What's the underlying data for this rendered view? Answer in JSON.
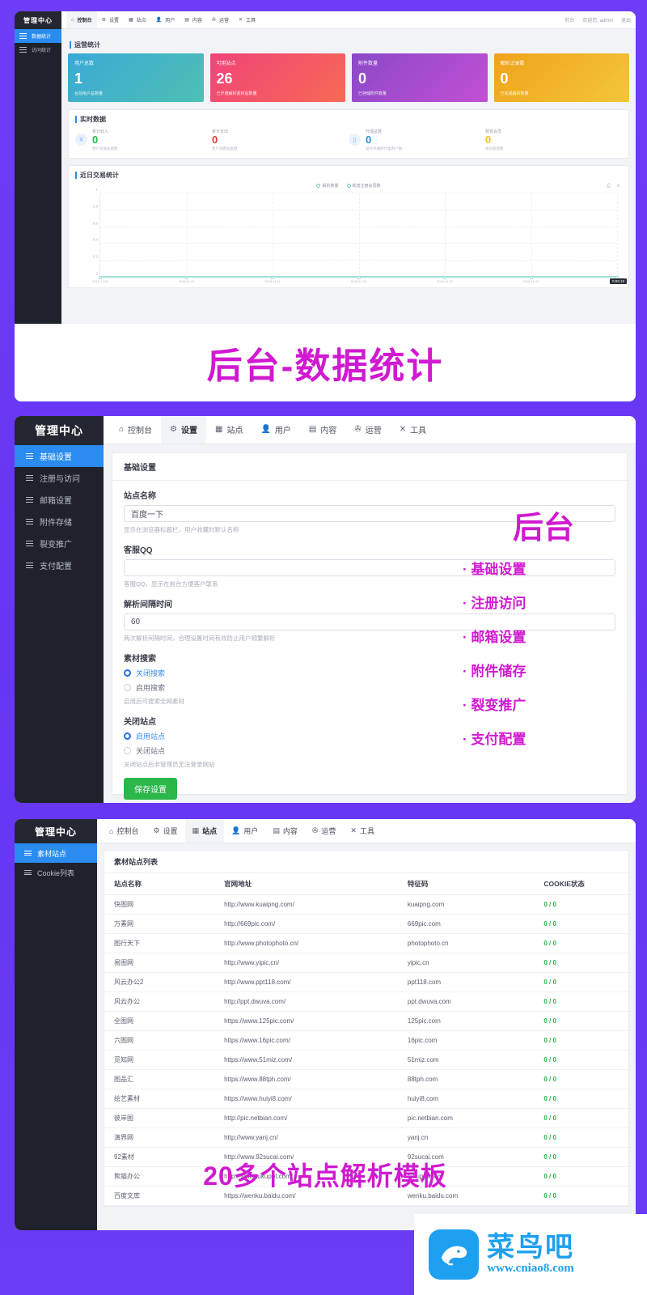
{
  "brand": "管理中心",
  "nav": {
    "tabs": [
      {
        "label": "控制台",
        "icon": "home-icon"
      },
      {
        "label": "设置",
        "icon": "gear-icon"
      },
      {
        "label": "站点",
        "icon": "grid-icon"
      },
      {
        "label": "用户",
        "icon": "users-icon"
      },
      {
        "label": "内容",
        "icon": "document-icon"
      },
      {
        "label": "运营",
        "icon": "refresh-icon"
      },
      {
        "label": "工具",
        "icon": "tools-icon"
      }
    ],
    "right": {
      "front": "前台",
      "welcome": "欢迎您, admin",
      "logout": "退出"
    }
  },
  "panel1": {
    "sidebar": [
      {
        "label": "数据统计",
        "active": true
      },
      {
        "label": "访问统计",
        "active": false
      }
    ],
    "active_tab": "控制台",
    "section_ops": "运营统计",
    "stats": [
      {
        "label": "用户总数",
        "value": "1",
        "sub": "台前用户总数量",
        "color_from": "#3aa9d6",
        "color_to": "#4ec0b4"
      },
      {
        "label": "可用站点",
        "value": "26",
        "sub": "已开通解析素材站数量",
        "color_from": "#f0437a",
        "color_to": "#f76a55"
      },
      {
        "label": "附件数量",
        "value": "0",
        "sub": "已存储附件数量",
        "color_from": "#8a49c8",
        "color_to": "#c34fd4"
      },
      {
        "label": "解析记录数",
        "value": "0",
        "sub": "已完成解析数量",
        "color_from": "#f0a31a",
        "color_to": "#f3c53a"
      }
    ],
    "section_realtime": "实时数据",
    "realtime": [
      {
        "label": "累计收入",
        "value": "0",
        "sub": "用户充值总金额",
        "color": "#2bb74a",
        "icon": "yen-icon"
      },
      {
        "label": "累计支出",
        "value": "0",
        "sub": "用户消费总金额",
        "color": "#e23b3b",
        "icon": ""
      },
      {
        "label": "代理总数",
        "value": "0",
        "sub": "站点开通的代理用户数",
        "color": "#1f8fe0",
        "icon": "card-icon"
      },
      {
        "label": "裂变会员",
        "value": "0",
        "sub": "会员裂变数",
        "color": "#f0c020",
        "icon": ""
      }
    ],
    "section_chart": "近日交易统计",
    "chart_tools": "⎙ ≡",
    "time_badge": "0:06:18"
  },
  "chart_data": {
    "type": "line",
    "title": "近日交易统计",
    "xlabel": "",
    "ylabel": "",
    "ylim": [
      0,
      1
    ],
    "yticks": [
      "0",
      "0.2",
      "0.4",
      "0.6",
      "0.8",
      "1"
    ],
    "grid": true,
    "legend_position": "top",
    "x": [
      "2016.11.09",
      "2016.11.10",
      "2016.11.11",
      "2016.11.12",
      "2016.11.13",
      "2016.11.14",
      "2016.11.15"
    ],
    "series": [
      {
        "name": "解析数量",
        "values": [
          0,
          0,
          0,
          0,
          0,
          0,
          0
        ],
        "color": "#7fd3cb"
      },
      {
        "name": "新增注册会员数",
        "values": [
          0,
          0,
          0,
          0,
          0,
          0,
          0
        ],
        "color": "#9fe0d9"
      }
    ]
  },
  "banner1": {
    "text": "后台-数据统计"
  },
  "panel2": {
    "active_tab": "设置",
    "sidebar": [
      {
        "label": "基础设置",
        "active": true
      },
      {
        "label": "注册与访问",
        "active": false
      },
      {
        "label": "邮箱设置",
        "active": false
      },
      {
        "label": "附件存储",
        "active": false
      },
      {
        "label": "裂变推广",
        "active": false
      },
      {
        "label": "支付配置",
        "active": false
      }
    ],
    "form_title": "基础设置",
    "fields": [
      {
        "label": "站点名称",
        "value": "百度一下",
        "placeholder": "",
        "help": "显示在浏览器标题栏，用户收藏时默认名称"
      },
      {
        "label": "客服QQ",
        "value": "",
        "placeholder": "",
        "help": "客服QQ，显示在前台方便客户联系"
      },
      {
        "label": "解析间隔时间",
        "value": "60",
        "placeholder": "",
        "help": "两次解析间隔时间，合理设置时间有效防止用户频繁解析"
      }
    ],
    "radio_groups": [
      {
        "label": "素材搜索",
        "options": [
          {
            "label": "关闭搜索",
            "selected": true
          },
          {
            "label": "启用搜索",
            "selected": false
          }
        ],
        "help": "启用后可搜索全网素材"
      },
      {
        "label": "关闭站点",
        "options": [
          {
            "label": "启用站点",
            "selected": true
          },
          {
            "label": "关闭站点",
            "selected": false
          }
        ],
        "help": "关闭站点后非管理员无法登录网站"
      }
    ],
    "save_label": "保存设置",
    "overlay": {
      "title": "后台",
      "items": [
        "· 基础设置",
        "· 注册访问",
        "· 邮箱设置",
        "· 附件储存",
        "· 裂变推广",
        "· 支付配置"
      ]
    }
  },
  "panel3": {
    "active_tab": "站点",
    "sidebar": [
      {
        "label": "素材站点",
        "active": true
      },
      {
        "label": "Cookie列表",
        "active": false
      }
    ],
    "table_title": "素材站点列表",
    "columns": [
      "站点名称",
      "官网地址",
      "特征码",
      "COOKIE状态"
    ],
    "rows": [
      [
        "快图网",
        "http://www.kuaipng.com/",
        "kuaipng.com",
        "0 / 0"
      ],
      [
        "万素网",
        "http://669pic.com/",
        "669pic.com",
        "0 / 0"
      ],
      [
        "图行天下",
        "http://www.photophoto.cn/",
        "photophoto.cn",
        "0 / 0"
      ],
      [
        "易图网",
        "http://www.yipic.cn/",
        "yipic.cn",
        "0 / 0"
      ],
      [
        "风云办公2",
        "http://www.ppt118.com/",
        "ppt118.com",
        "0 / 0"
      ],
      [
        "风云办公",
        "http://ppt.dwuva.com/",
        "ppt.dwuva.com",
        "0 / 0"
      ],
      [
        "全图网",
        "https://www.125pic.com/",
        "125pic.com",
        "0 / 0"
      ],
      [
        "六图网",
        "https://www.16pic.com/",
        "16pic.com",
        "0 / 0"
      ],
      [
        "觅知网",
        "https://www.51miz.com/",
        "51miz.com",
        "0 / 0"
      ],
      [
        "图品汇",
        "https://www.88tph.com/",
        "88tph.com",
        "0 / 0"
      ],
      [
        "绘艺素材",
        "https://www.huiyi8.com/",
        "huiyi8.com",
        "0 / 0"
      ],
      [
        "彼岸图",
        "http://pic.netbian.com/",
        "pic.netbian.com",
        "0 / 0"
      ],
      [
        "演界网",
        "http://www.yanj.cn/",
        "yanj.cn",
        "0 / 0"
      ],
      [
        "92素材",
        "http://www.92sucai.com/",
        "92sucai.com",
        "0 / 0"
      ],
      [
        "熊猫办公",
        "http://www.tukuppt.com/",
        "tukuppt.com",
        "0 / 0"
      ],
      [
        "百度文库",
        "https://wenku.baidu.com/",
        "wenku.baidu.com",
        "0 / 0"
      ]
    ],
    "overlay_band": "20多个站点解析模板"
  },
  "watermark": {
    "name": "菜鸟吧",
    "url": "www.cniao8.com"
  }
}
